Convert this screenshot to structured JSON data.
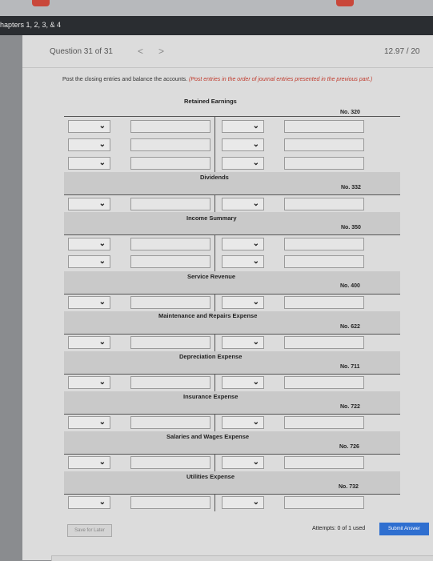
{
  "breadcrumb": "hapters 1, 2, 3, & 4",
  "question": {
    "label": "Question 31 of 31",
    "score": "12.97 / 20"
  },
  "nav": {
    "prev": "<",
    "next": ">"
  },
  "instructions": {
    "main": "Post the closing entries and balance the accounts.",
    "note": "(Post entries in the order of journal entries presented in the previous part.)"
  },
  "accounts": [
    {
      "title": "Retained Earnings",
      "number": "No. 320"
    },
    {
      "title": "Dividends",
      "number": "No. 332"
    },
    {
      "title": "Income Summary",
      "number": "No. 350"
    },
    {
      "title": "Service Revenue",
      "number": "No. 400"
    },
    {
      "title": "Maintenance and Repairs Expense",
      "number": "No. 622"
    },
    {
      "title": "Depreciation Expense",
      "number": "No. 711"
    },
    {
      "title": "Insurance Expense",
      "number": "No. 722"
    },
    {
      "title": "Salaries and Wages Expense",
      "number": "No. 726"
    },
    {
      "title": "Utilities Expense",
      "number": "No. 732"
    }
  ],
  "footer": {
    "save_label": "Save for Later",
    "attempts": "Attempts: 0 of 1 used",
    "submit_label": "Submit Answer"
  },
  "icons": {
    "dropdown": "chevron-down-icon"
  }
}
